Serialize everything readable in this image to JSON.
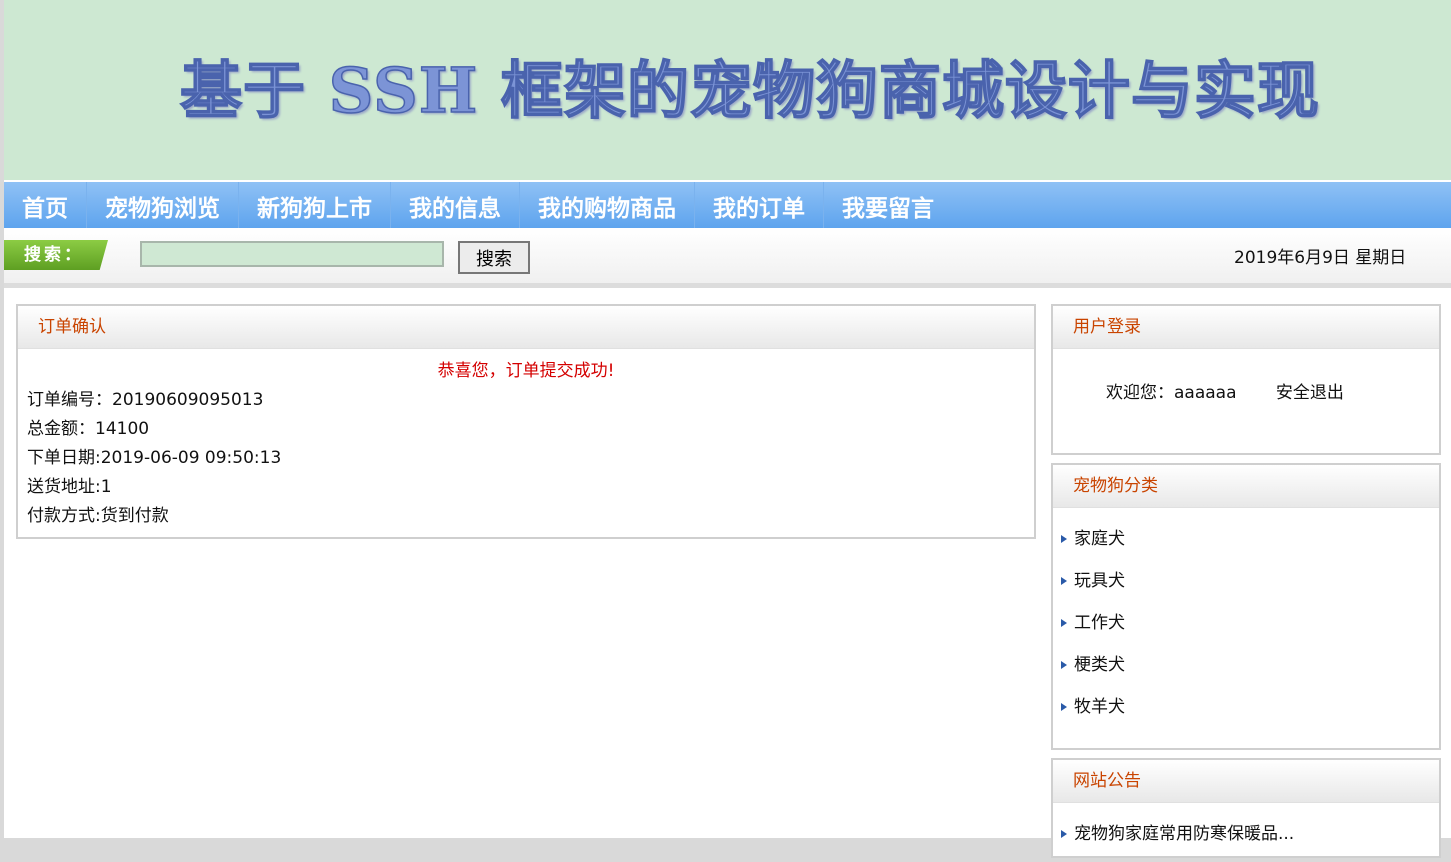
{
  "banner": {
    "title": "基于 SSH 框架的宠物狗商城设计与实现"
  },
  "nav": {
    "items": [
      "首页",
      "宠物狗浏览",
      "新狗狗上市",
      "我的信息",
      "我的购物商品",
      "我的订单",
      "我要留言"
    ]
  },
  "search": {
    "tag_label": "搜索：",
    "input_value": "",
    "button_label": "搜索"
  },
  "date_text": "2019年6月9日 星期日",
  "order": {
    "header": "订单确认",
    "success_message": "恭喜您，订单提交成功!",
    "lines": [
      "订单编号：20190609095013",
      "总金额：14100",
      "下单日期:2019-06-09 09:50:13",
      "送货地址:1",
      "付款方式:货到付款"
    ]
  },
  "login": {
    "header": "用户登录",
    "welcome": "欢迎您：aaaaaa",
    "logout": "安全退出"
  },
  "category": {
    "header": "宠物狗分类",
    "items": [
      "家庭犬",
      "玩具犬",
      "工作犬",
      "梗类犬",
      "牧羊犬"
    ]
  },
  "notice": {
    "header": "网站公告",
    "items": [
      "宠物狗家庭常用防寒保暖品..."
    ]
  },
  "colors": {
    "nav": "#6aabf0",
    "banner": "#cde8d2",
    "panel_title": "#c94400",
    "success": "#d40000"
  }
}
